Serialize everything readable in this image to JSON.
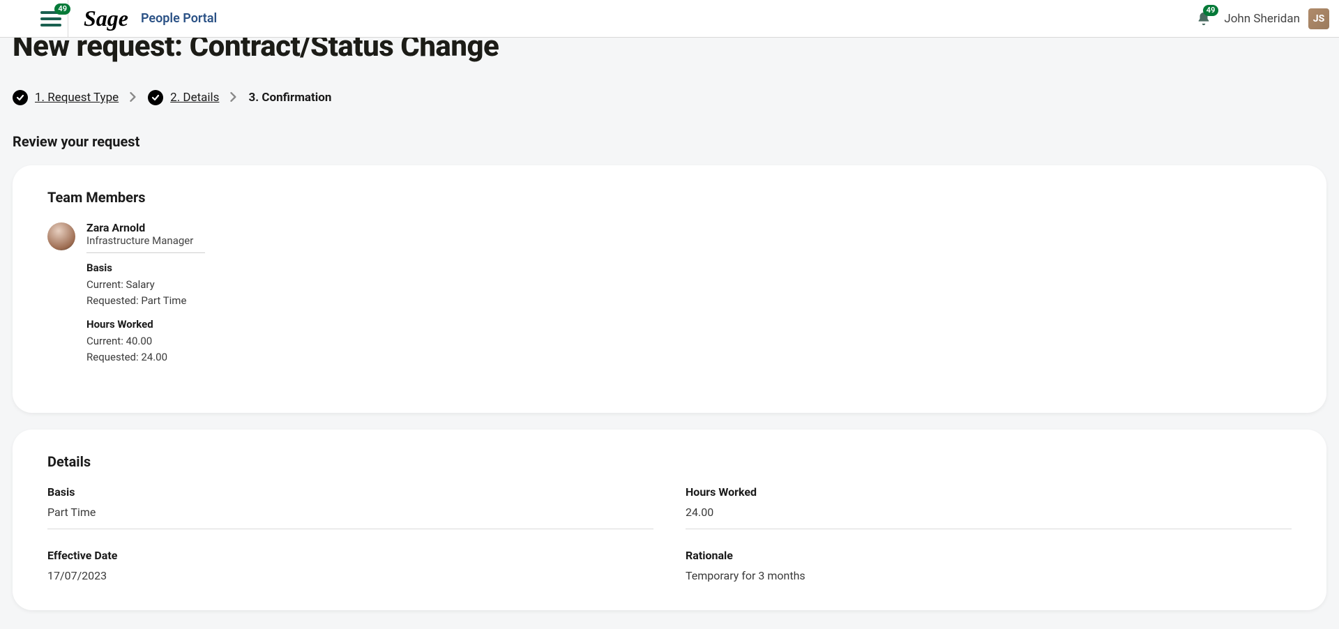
{
  "header": {
    "menu_badge": "49",
    "app_name_text": "People Portal",
    "notif_badge": "49",
    "user_name": "John Sheridan",
    "avatar_initials": "JS"
  },
  "page": {
    "title": "New request: Contract/Status Change",
    "stepper": [
      {
        "label": "1. Request Type",
        "completed": true,
        "link": true
      },
      {
        "label": "2. Details",
        "completed": true,
        "link": true
      },
      {
        "label": "3. Confirmation",
        "completed": false,
        "link": false
      }
    ],
    "review_heading": "Review your request"
  },
  "team": {
    "heading": "Team Members",
    "member": {
      "name": "Zara Arnold",
      "role": "Infrastructure Manager",
      "basis": {
        "label": "Basis",
        "current": "Current: Salary",
        "requested": "Requested: Part Time"
      },
      "hours": {
        "label": "Hours Worked",
        "current": "Current: 40.00",
        "requested": "Requested: 24.00"
      }
    }
  },
  "details": {
    "heading": "Details",
    "basis_label": "Basis",
    "basis_value": "Part Time",
    "hours_label": "Hours Worked",
    "hours_value": "24.00",
    "effective_label": "Effective Date",
    "effective_value": "17/07/2023",
    "rationale_label": "Rationale",
    "rationale_value": "Temporary for 3 months"
  }
}
